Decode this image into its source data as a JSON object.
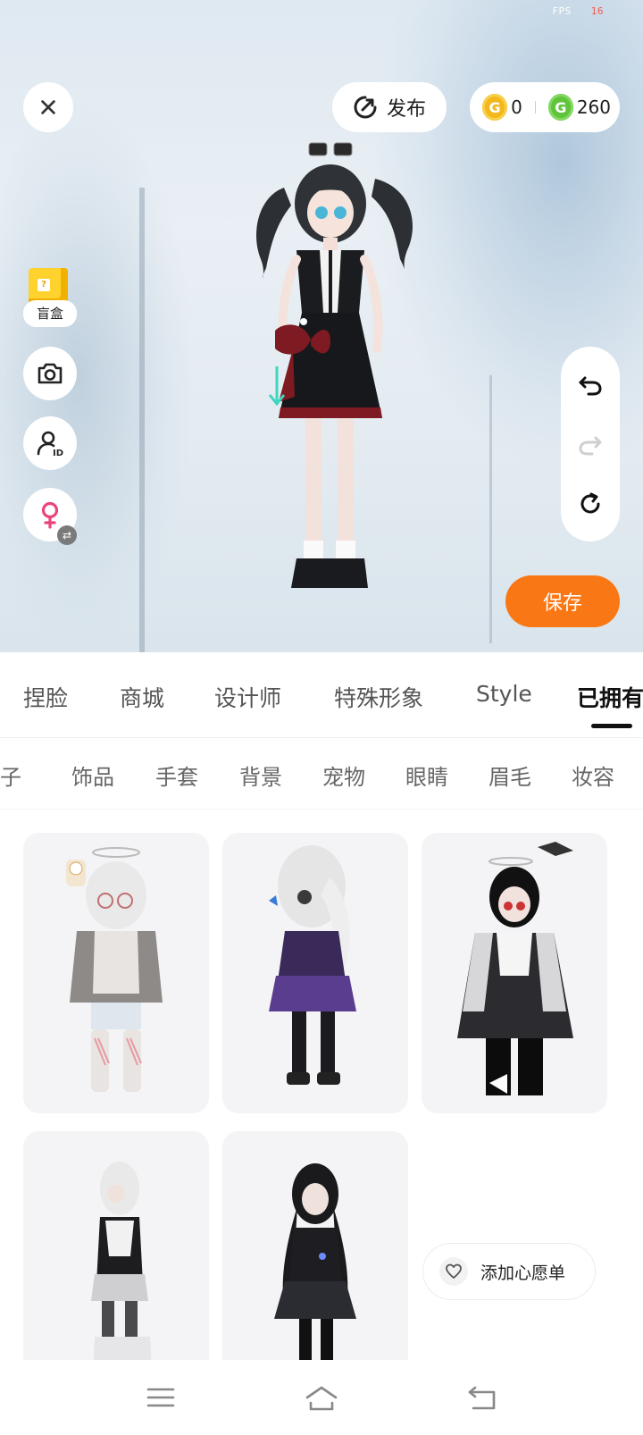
{
  "status": {
    "fps_label": "FPS",
    "fps_value": "16"
  },
  "toolbar": {
    "publish_label": "发布",
    "gold_coins": "0",
    "green_coins": "260",
    "save_label": "保存"
  },
  "side": {
    "blindbox_label": "盲盒",
    "blindbox_box_mark": "?",
    "gender_swap_glyph": "⇄"
  },
  "tabs": [
    {
      "label": "捏脸"
    },
    {
      "label": "商城"
    },
    {
      "label": "设计师"
    },
    {
      "label": "特殊形象"
    },
    {
      "label": "Style"
    },
    {
      "label": "已拥有"
    }
  ],
  "subtabs": [
    {
      "label": "鞋子"
    },
    {
      "label": "饰品"
    },
    {
      "label": "手套"
    },
    {
      "label": "背景"
    },
    {
      "label": "宠物"
    },
    {
      "label": "眼睛"
    },
    {
      "label": "眉毛"
    },
    {
      "label": "妆容"
    }
  ],
  "wishlist": {
    "label": "添加心愿单"
  },
  "colors": {
    "accent": "#f97815",
    "gold": "#f3b81c",
    "green": "#5ec43a",
    "fps_value": "#f15a4a"
  },
  "icons": [
    "close-icon",
    "publish-icon",
    "gold-coin-icon",
    "green-coin-icon",
    "blindbox-icon",
    "camera-icon",
    "id-icon",
    "female-icon",
    "undo-icon",
    "redo-icon",
    "reset-icon",
    "heart-icon",
    "menu-icon",
    "home-icon",
    "back-icon"
  ]
}
